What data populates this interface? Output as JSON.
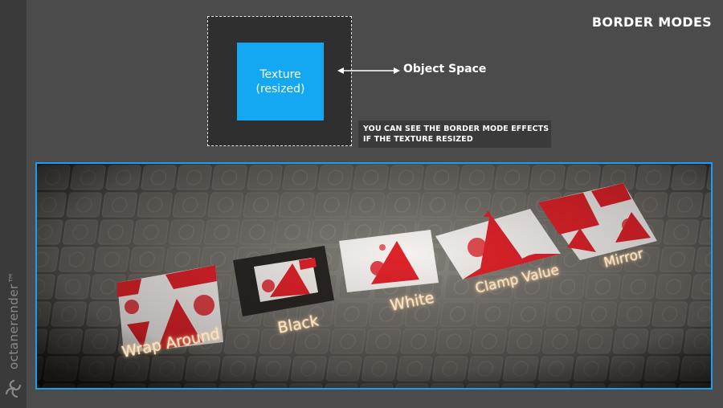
{
  "brand": {
    "name": "octanerender",
    "trademark": "™"
  },
  "page": {
    "title": "BORDER MODES"
  },
  "diagram": {
    "texture_line1": "Texture",
    "texture_line2": "(resized)",
    "object_space_label": "Object Space",
    "note_line1": "YOU CAN SEE THE BORDER MODE EFFECTS",
    "note_line2": "IF THE TEXTURE RESIZED"
  },
  "colors": {
    "accent": "#14a7f2",
    "panel_border": "#1a9ff0",
    "texture_red": "#e0232a",
    "label_glow": "#ffc98a"
  },
  "render": {
    "modes": [
      {
        "label": "Wrap Around"
      },
      {
        "label": "Black"
      },
      {
        "label": "White"
      },
      {
        "label": "Clamp Value"
      },
      {
        "label": "Mirror"
      }
    ]
  }
}
